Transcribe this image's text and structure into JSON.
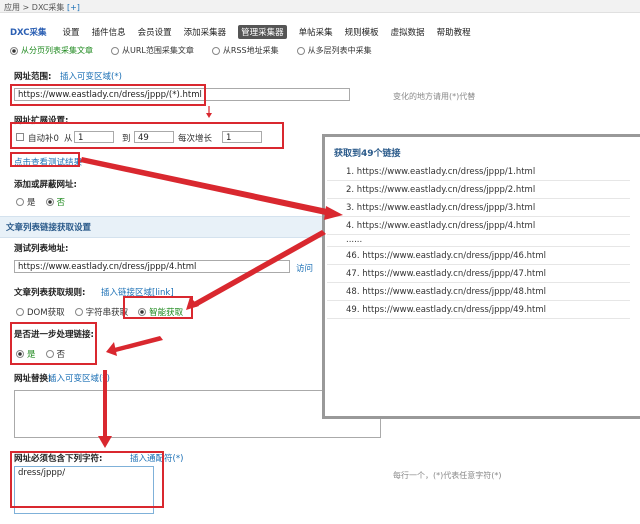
{
  "breadcrumb": {
    "path": "应用 > DXC采集",
    "plus": "[+]"
  },
  "nav": {
    "brand": "DXC采集",
    "items": [
      "设置",
      "插件信息",
      "会员设置",
      "添加采集器",
      "管理采集器",
      "单帖采集",
      "规则模板",
      "虚拟数据",
      "帮助教程"
    ],
    "active_index": 4
  },
  "modes": [
    {
      "label": "从分页列表采集文章",
      "active": true
    },
    {
      "label": "从URL范围采集文章",
      "active": false
    },
    {
      "label": "从RSS地址采集",
      "active": false
    },
    {
      "label": "从多层列表中采集",
      "active": false
    }
  ],
  "url_range": {
    "label": "网址范围:",
    "insert_link": "插入可变区域(*)",
    "value": "https://www.eastlady.cn/dress/jppp/(*).html",
    "hint": "变化的地方请用(*)代替"
  },
  "expand": {
    "label": "网址扩展设置:",
    "autofill_label": "自动补0",
    "from_label": "从",
    "from_value": "1",
    "to_label": "到",
    "to_value": "49",
    "step_label": "每次增长",
    "step_value": "1"
  },
  "test_link": "点击查看测试结果",
  "exclude": {
    "label": "添加或屏蔽网址:",
    "yes": "是",
    "no": "否"
  },
  "article_section": "文章列表链接获取设置",
  "test_list": {
    "label": "测试列表地址:",
    "value": "https://www.eastlady.cn/dress/jppp/4.html",
    "visit": "访问"
  },
  "rule": {
    "label": "文章列表获取规则:",
    "insert_link": "插入链接区域[link]",
    "options": [
      "DOM获取",
      "字符串获取",
      "智能获取"
    ],
    "selected_index": 2
  },
  "further": {
    "label": "是否进一步处理链接:",
    "yes": "是",
    "no": "否"
  },
  "replace": {
    "label": "网址替换:",
    "insert_link": "插入可变区域(*)"
  },
  "must_contain": {
    "label": "网址必须包含下列字符:",
    "insert_link": "插入通配符(*)",
    "value": "dress/jppp/",
    "hint": "每行一个，(*)代表任意字符(*)"
  },
  "popup": {
    "title": "获取到49个链接",
    "items": [
      "1. https://www.eastlady.cn/dress/jppp/1.html",
      "2. https://www.eastlady.cn/dress/jppp/2.html",
      "3. https://www.eastlady.cn/dress/jppp/3.html",
      "4. https://www.eastlady.cn/dress/jppp/4.html",
      "......",
      "46. https://www.eastlady.cn/dress/jppp/46.html",
      "47. https://www.eastlady.cn/dress/jppp/47.html",
      "48. https://www.eastlady.cn/dress/jppp/48.html",
      "49. https://www.eastlady.cn/dress/jppp/49.html"
    ]
  },
  "colors": {
    "annotation_red": "#d9282f",
    "link_blue": "#1a6fb5",
    "active_green": "#1f8a1f"
  }
}
